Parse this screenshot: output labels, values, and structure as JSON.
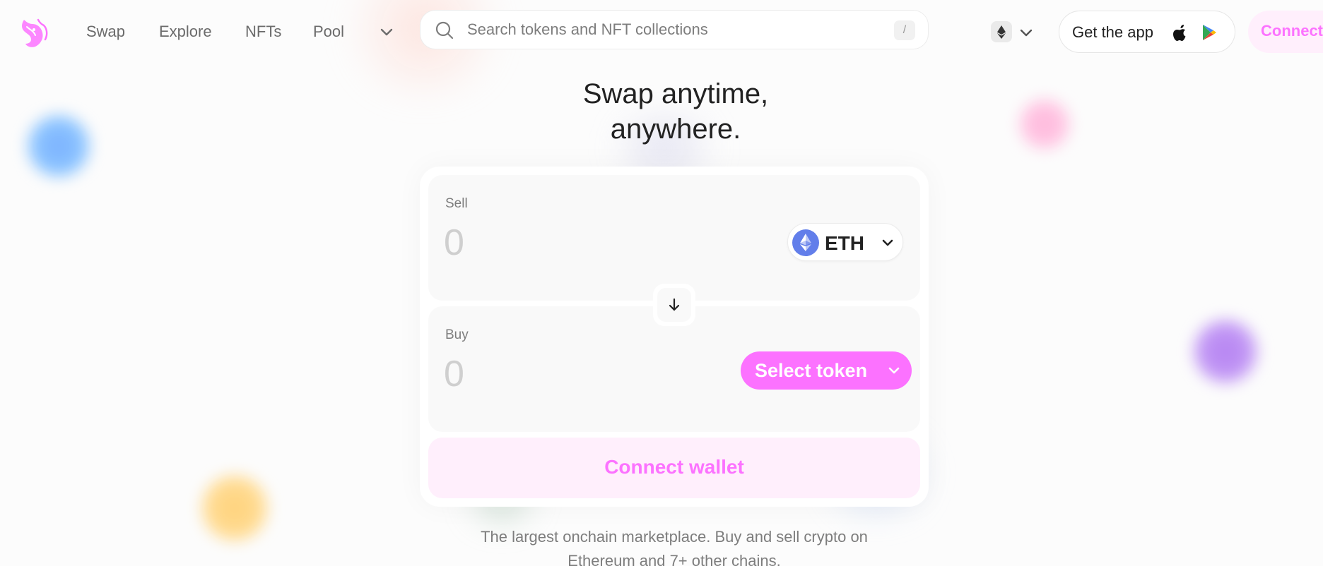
{
  "colors": {
    "accent": "#fc72ff",
    "accent_soft": "#ffeffc",
    "text": "#222222",
    "muted": "#7d7d7d",
    "panel": "#f9f9f9"
  },
  "nav": {
    "links": [
      {
        "label": "Swap"
      },
      {
        "label": "Explore"
      },
      {
        "label": "NFTs"
      },
      {
        "label": "Pool"
      }
    ],
    "more_icon": "chevron-down-icon",
    "search": {
      "placeholder": "Search tokens and NFT collections",
      "shortcut": "/"
    },
    "chain_icon": "ethereum-icon",
    "get_app_label": "Get the app",
    "connect_label": "Connect"
  },
  "hero": {
    "title_line1": "Swap anytime,",
    "title_line2": "anywhere."
  },
  "swap": {
    "sell": {
      "label": "Sell",
      "amount_placeholder": "0",
      "token": "ETH"
    },
    "buy": {
      "label": "Buy",
      "amount_placeholder": "0",
      "token_button": "Select token"
    },
    "flip_icon": "arrow-down-icon",
    "connect_wallet_label": "Connect wallet"
  },
  "tagline": {
    "line1": "The largest onchain marketplace. Buy and sell crypto on",
    "line2": "Ethereum and 7+ other chains."
  }
}
